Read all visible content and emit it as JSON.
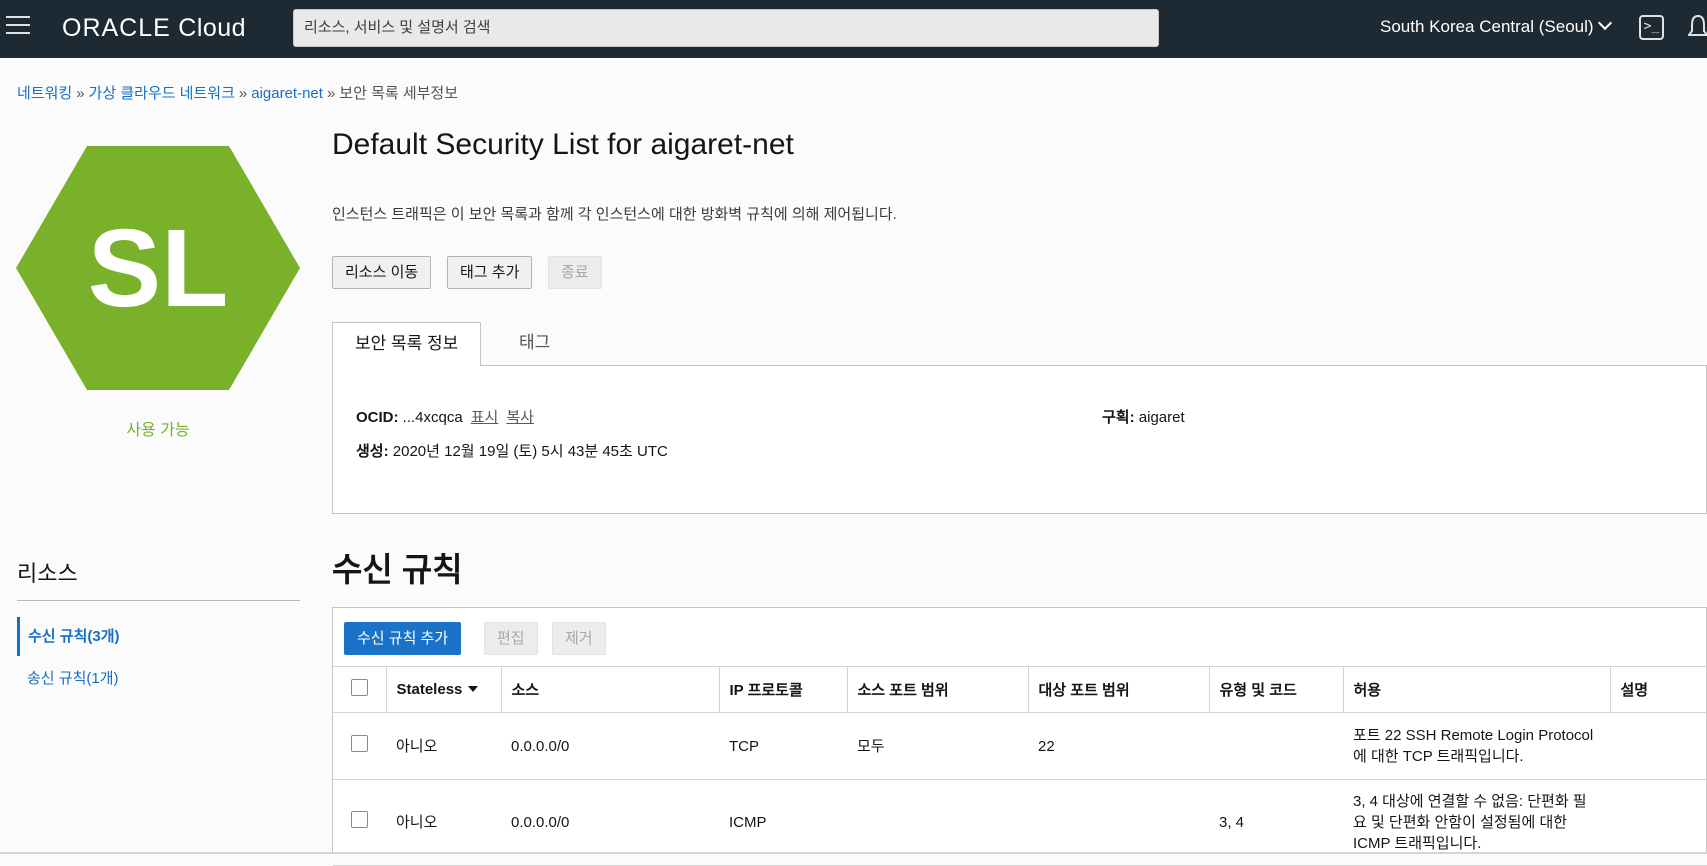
{
  "header": {
    "logo_oracle": "ORACLE",
    "logo_cloud": "Cloud",
    "search_placeholder": "리소스, 서비스 및 설명서 검색",
    "region": "South Korea Central (Seoul)",
    "cloudshell_glyph": ">_"
  },
  "breadcrumb": {
    "items": [
      "네트워킹",
      "가상 클라우드 네트워크",
      "aigaret-net"
    ],
    "current": "보안 목록 세부정보",
    "separator": "»"
  },
  "badge": {
    "initials": "SL",
    "status": "사용 가능",
    "color": "#7ab12a"
  },
  "page": {
    "title": "Default Security List for aigaret-net",
    "description": "인스턴스 트래픽은 이 보안 목록과 함께 각 인스턴스에 대한 방화벽 규칙에 의해 제어됩니다."
  },
  "actions": {
    "move": "리소스 이동",
    "add_tag": "태그 추가",
    "terminate": "종료"
  },
  "tabs": [
    "보안 목록 정보",
    "태그"
  ],
  "info": {
    "ocid_label": "OCID:",
    "ocid_value": "...4xcqca",
    "show": "표시",
    "copy": "복사",
    "compartment_label": "구획:",
    "compartment_value": "aigaret",
    "created_label": "생성:",
    "created_value": "2020년 12월 19일 (토) 5시 43분 45초 UTC"
  },
  "resources": {
    "title": "리소스",
    "items": [
      "수신 규칙(3개)",
      "송신 규칙(1개)"
    ]
  },
  "ingress": {
    "title": "수신 규칙",
    "add": "수신 규칙 추가",
    "edit": "편집",
    "remove": "제거",
    "columns": [
      "Stateless",
      "소스",
      "IP 프로토콜",
      "소스 포트 범위",
      "대상 포트 범위",
      "유형 및 코드",
      "허용",
      "설명"
    ],
    "rows": [
      {
        "stateless": "아니오",
        "source": "0.0.0.0/0",
        "protocol": "TCP",
        "src_port": "모두",
        "dst_port": "22",
        "type_code": "",
        "allows": "포트 22 SSH Remote Login Protocol에 대한 TCP 트래픽입니다.",
        "description": ""
      },
      {
        "stateless": "아니오",
        "source": "0.0.0.0/0",
        "protocol": "ICMP",
        "src_port": "",
        "dst_port": "",
        "type_code": "3, 4",
        "allows": "3, 4 대상에 연결할 수 없음: 단편화 필요 및 단편화 안함이 설정됨에 대한 ICMP 트래픽입니다.",
        "description": ""
      }
    ]
  }
}
